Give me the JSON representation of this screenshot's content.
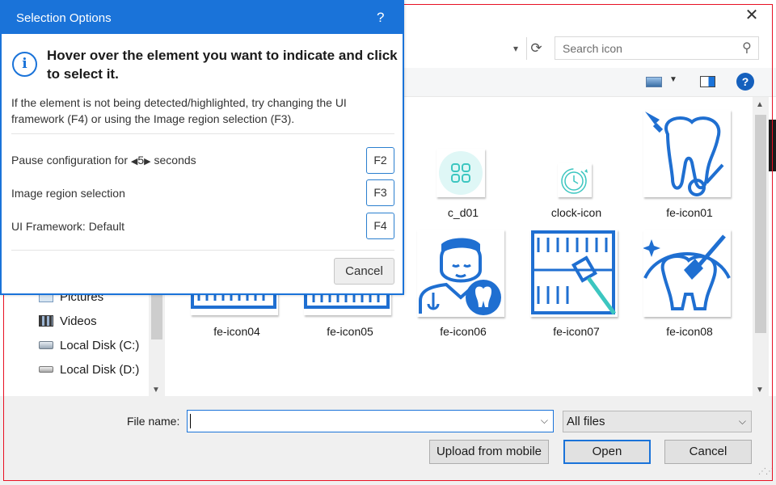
{
  "selection_options": {
    "title": "Selection Options",
    "help": "?",
    "info_glyph": "i",
    "heading": "Hover over the element you want to indicate and click to select it.",
    "description": "If the element is not being detected/highlighted, try changing the UI framework (F4) or using the Image region selection (F3).",
    "pause": {
      "prefix": "Pause configuration for",
      "value": "5",
      "suffix": "seconds",
      "key": "F2"
    },
    "image_region": {
      "label": "Image region selection",
      "key": "F3"
    },
    "ui_framework": {
      "label": "UI Framework:",
      "value": "Default",
      "key": "F4"
    },
    "cancel": "Cancel"
  },
  "file_dialog": {
    "close": "✕",
    "search_placeholder": "Search icon",
    "help": "?",
    "nav_items": [
      {
        "label": "Pictures",
        "icon": "pictures-icon"
      },
      {
        "label": "Videos",
        "icon": "videos-icon"
      },
      {
        "label": "Local Disk (C:)",
        "icon": "disk-icon"
      },
      {
        "label": "Local Disk (D:)",
        "icon": "disk-icon"
      }
    ],
    "files_row1": [
      "c_d01",
      "clock-icon",
      "fe-icon01"
    ],
    "files_row2": [
      "fe-icon04",
      "fe-icon05",
      "fe-icon06",
      "fe-icon07",
      "fe-icon08"
    ],
    "filename_label": "File name:",
    "filename_value": "",
    "filetype": "All files",
    "upload_button": "Upload from mobile",
    "open_button": "Open",
    "cancel_button": "Cancel"
  },
  "colors": {
    "accent": "#1a73d9",
    "icon_blue": "#1f6fd1",
    "teal": "#3cc6c0",
    "frame_red": "#e81123"
  }
}
